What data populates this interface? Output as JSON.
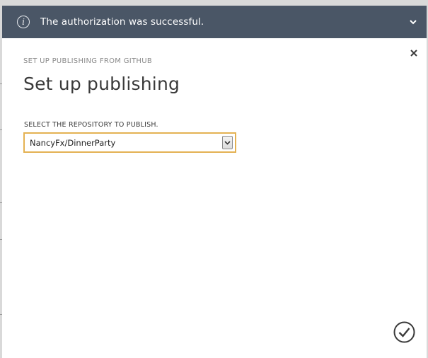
{
  "notification": {
    "message": "The authorization was successful.",
    "info_icon": "info-icon",
    "expand_icon": "chevron-down-icon"
  },
  "dialog": {
    "eyebrow": "SET UP PUBLISHING FROM GITHUB",
    "title": "Set up publishing",
    "close_icon": "close-icon",
    "repository": {
      "label": "SELECT THE REPOSITORY TO PUBLISH.",
      "selected": "NancyFx/DinnerParty"
    },
    "confirm_icon": "checkmark-circle-icon"
  },
  "colors": {
    "notification_bg": "#4a5666",
    "select_focus_border": "#e4b253",
    "dialog_bg": "#ffffff"
  }
}
